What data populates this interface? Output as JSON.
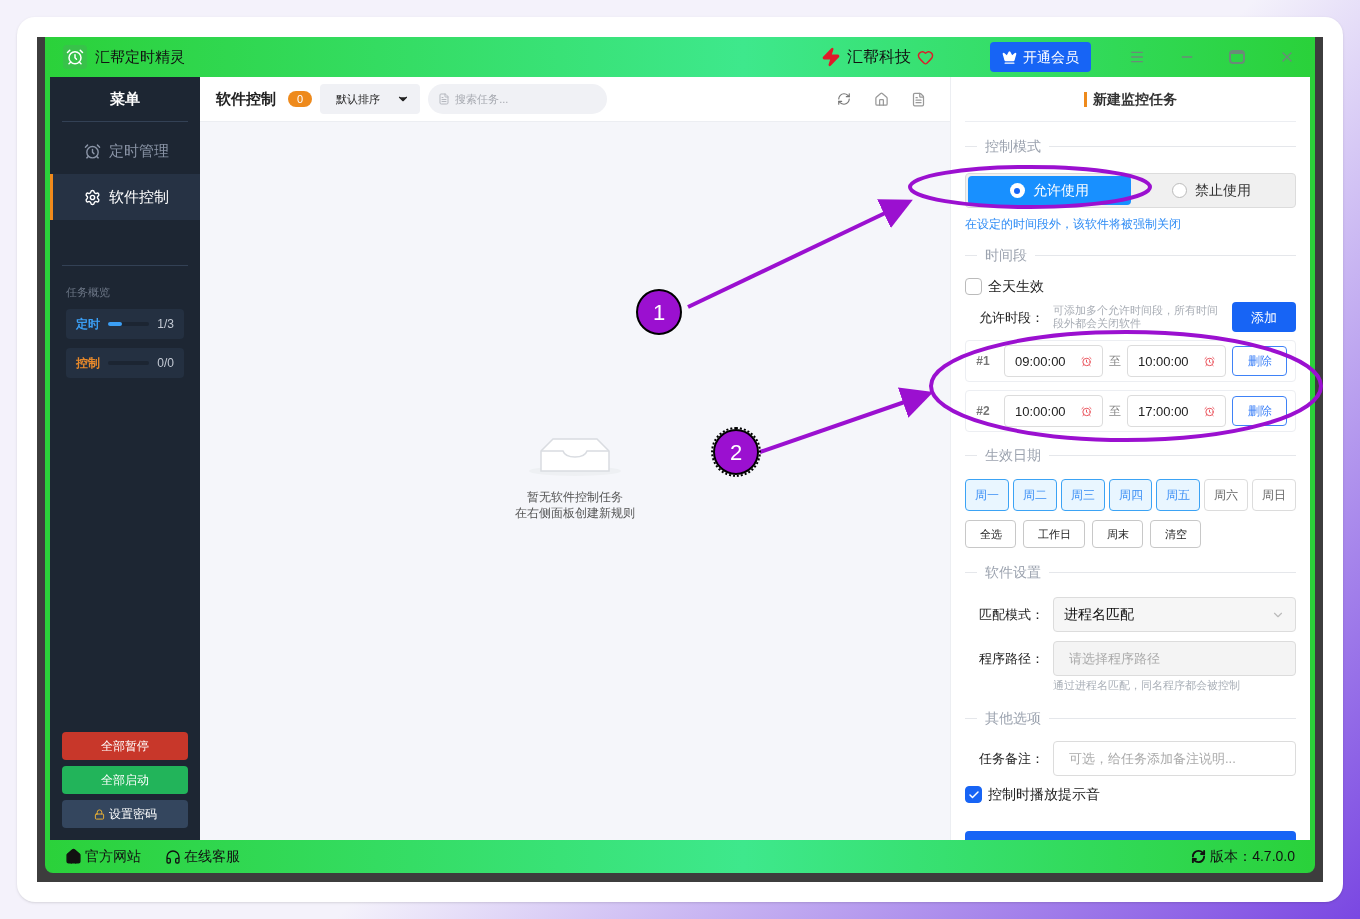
{
  "window": {
    "title": "汇帮定时精灵",
    "brand": "汇帮科技",
    "vip_button": "开通会员"
  },
  "sidebar": {
    "title": "菜单",
    "nav": [
      {
        "label": "定时管理",
        "selected": false
      },
      {
        "label": "软件控制",
        "selected": true
      }
    ],
    "overview_title": "任务概览",
    "overview": [
      {
        "label": "定时",
        "value": "1/3",
        "level": 0.33,
        "color": "#3b9ff5"
      },
      {
        "label": "控制",
        "value": "0/0",
        "level": 0,
        "color": "#e8892a"
      }
    ],
    "buttons": [
      {
        "label": "全部暂停",
        "kind": "danger"
      },
      {
        "label": "全部启动",
        "kind": "success"
      },
      {
        "label": "设置密码",
        "kind": "lock"
      }
    ]
  },
  "main": {
    "title": "软件控制",
    "count": "0",
    "sort": "默认排序",
    "search": {
      "placeholder": "搜索任务..."
    },
    "empty": [
      "暂无软件控制任务",
      "在右侧面板创建新规则"
    ]
  },
  "panel": {
    "title": "新建监控任务",
    "mode_legend": "控制模式",
    "modes": [
      {
        "label": "允许使用",
        "selected": true
      },
      {
        "label": "禁止使用",
        "selected": false
      }
    ],
    "mode_hint": "在设定的时间段外，该软件将被强制关闭",
    "time_legend": "时间段",
    "all_day": {
      "label": "全天生效",
      "checked": false
    },
    "allow_label": "允许时段：",
    "allow_hint": "可添加多个允许时间段，所有时间段外都会关闭软件",
    "add_button": "添加",
    "slots": [
      {
        "index": "#1",
        "start": "09:00:00",
        "sep": "至",
        "end": "10:00:00",
        "delete": "删除"
      },
      {
        "index": "#2",
        "start": "10:00:00",
        "sep": "至",
        "end": "17:00:00",
        "delete": "删除"
      }
    ],
    "date_legend": "生效日期",
    "days": [
      {
        "label": "周一",
        "selected": true
      },
      {
        "label": "周二",
        "selected": true
      },
      {
        "label": "周三",
        "selected": true
      },
      {
        "label": "周四",
        "selected": true
      },
      {
        "label": "周五",
        "selected": true
      },
      {
        "label": "周六",
        "selected": false
      },
      {
        "label": "周日",
        "selected": false
      }
    ],
    "quick": [
      "全选",
      "工作日",
      "周末",
      "清空"
    ],
    "software_legend": "软件设置",
    "match_label": "匹配模式：",
    "match_value": "进程名匹配",
    "path_label": "程序路径：",
    "path_placeholder": "请选择程序路径",
    "path_hint": "通过进程名匹配，同名程序都会被控制",
    "other_legend": "其他选项",
    "note_label": "任务备注：",
    "note_placeholder": "可选，给任务添加备注说明...",
    "sound": {
      "label": "控制时播放提示音",
      "checked": true
    }
  },
  "footer": {
    "links": [
      "官方网站",
      "在线客服"
    ],
    "version": "版本：4.7.0.0"
  },
  "annotations": [
    {
      "label": "1"
    },
    {
      "label": "2"
    }
  ]
}
